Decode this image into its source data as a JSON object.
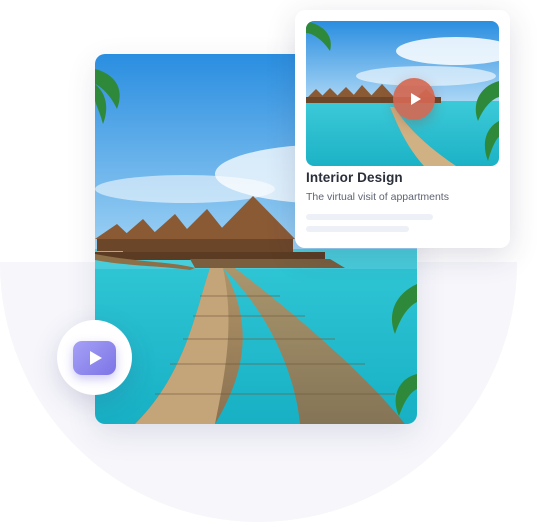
{
  "video_card": {
    "title": "Interior Design",
    "subtitle": "The virtual visit of appartments"
  },
  "icons": {
    "card_play": "play-icon",
    "main_play": "play-icon"
  },
  "colors": {
    "card_play_button": "#d46852",
    "main_play_button": "#8e86ee",
    "background_circle": "#f6f6fb"
  }
}
